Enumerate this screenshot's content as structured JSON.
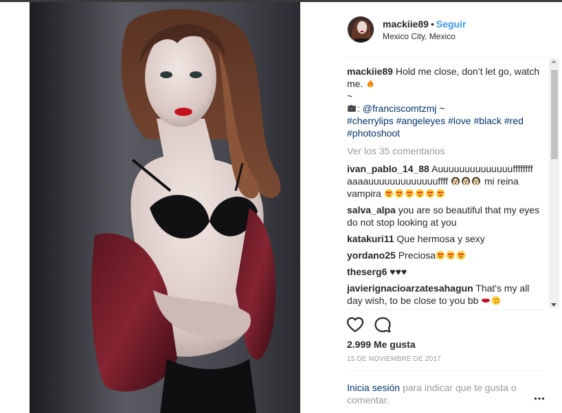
{
  "post": {
    "username": "mackiie89",
    "dot": "•",
    "follow_label": "Seguir",
    "location": "Mexico City, Mexico",
    "caption_text": "Hold me close, don’t let go, watch me.",
    "caption_tilde": "~",
    "credit_separator": ":",
    "credit_handle": "@franciscomtzmj",
    "credit_tilde": "~",
    "hashtags": [
      "#cherrylips",
      "#angeleyes",
      "#love",
      "#black",
      "#red",
      "#photoshoot"
    ],
    "view_all": "Ver los 35 comentarios",
    "comments": [
      {
        "user": "ivan_pablo_14_88",
        "text": "Auuuuuuuuuuuuuuffffffff aaaauuuuuuuuuuuuuffff",
        "text2": "mi reina vampira",
        "emojis_a": [
          "ghost-face",
          "ghost-face",
          "ghost-face"
        ],
        "emojis_b": [
          "heart-eyes",
          "heart-eyes",
          "heart-eyes",
          "heart-eyes",
          "heart-eyes",
          "heart-eyes"
        ]
      },
      {
        "user": "salva_alpa",
        "text": "you are so beautiful that my eyes do not stop looking at you"
      },
      {
        "user": "katakuri11",
        "text": "Que hermosa y sexy"
      },
      {
        "user": "yordano25",
        "text": "Preciosa",
        "emojis_b": [
          "heart-eyes",
          "heart-eyes",
          "heart-eyes"
        ]
      },
      {
        "user": "theserg6",
        "text": "♥♥♥"
      },
      {
        "user": "javierignacioarzatesahagun",
        "text": "That's my all day wish, to be close to you bb"
      }
    ],
    "likes": "2.999 Me gusta",
    "date": "15 DE NOVIEMBRE DE 2017",
    "login_link": "Inicia sesión",
    "login_text": "para indicar que te gusta o comentar."
  },
  "icons": {
    "like": "heart-outline-icon",
    "comment": "speech-bubble-icon",
    "more": "more-options-icon",
    "fire": "fire-emoji",
    "camera": "camera-emoji",
    "kiss": "kiss-lips-emoji",
    "wink": "kissing-face-emoji"
  },
  "colors": {
    "link_blue": "#3897f0",
    "hashtag": "#003569",
    "muted": "#999999",
    "text": "#262626"
  }
}
